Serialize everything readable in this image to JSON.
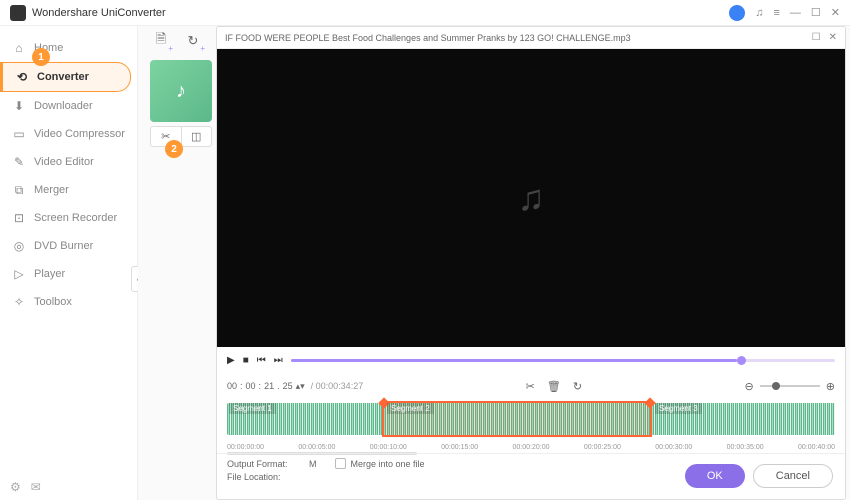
{
  "app_title": "Wondershare UniConverter",
  "sidebar": {
    "items": [
      {
        "icon": "⌂",
        "label": "Home"
      },
      {
        "icon": "⟲",
        "label": "Converter"
      },
      {
        "icon": "⬇",
        "label": "Downloader"
      },
      {
        "icon": "▭",
        "label": "Video Compressor"
      },
      {
        "icon": "✎",
        "label": "Video Editor"
      },
      {
        "icon": "⧉",
        "label": "Merger"
      },
      {
        "icon": "⊡",
        "label": "Screen Recorder"
      },
      {
        "icon": "◎",
        "label": "DVD Burner"
      },
      {
        "icon": "▷",
        "label": "Player"
      },
      {
        "icon": "✧",
        "label": "Toolbox"
      }
    ]
  },
  "badges": {
    "b1": "1",
    "b2": "2"
  },
  "editor": {
    "filename": "IF FOOD WERE PEOPLE   Best Food Challenges and Summer Pranks by 123 GO! CHALLENGE.mp3",
    "time_parts": [
      "00",
      "00",
      "21",
      "25"
    ],
    "duration": "/ 00:00:34:27",
    "segments": [
      "Segment 1",
      "Segment 2",
      "Segment 3"
    ],
    "ticks": [
      "00:00:00:00",
      "00:00:05:00",
      "00:00:10:00",
      "00:00:15:00",
      "00:00:20:00",
      "00:00:25:00",
      "00:00:30:00",
      "00:00:35:00",
      "00:00:40:00"
    ]
  },
  "footer": {
    "output_format": "Output Format:",
    "output_val": "M",
    "file_location": "File Location:",
    "merge": "Merge into one file",
    "ok": "OK",
    "cancel": "Cancel"
  }
}
